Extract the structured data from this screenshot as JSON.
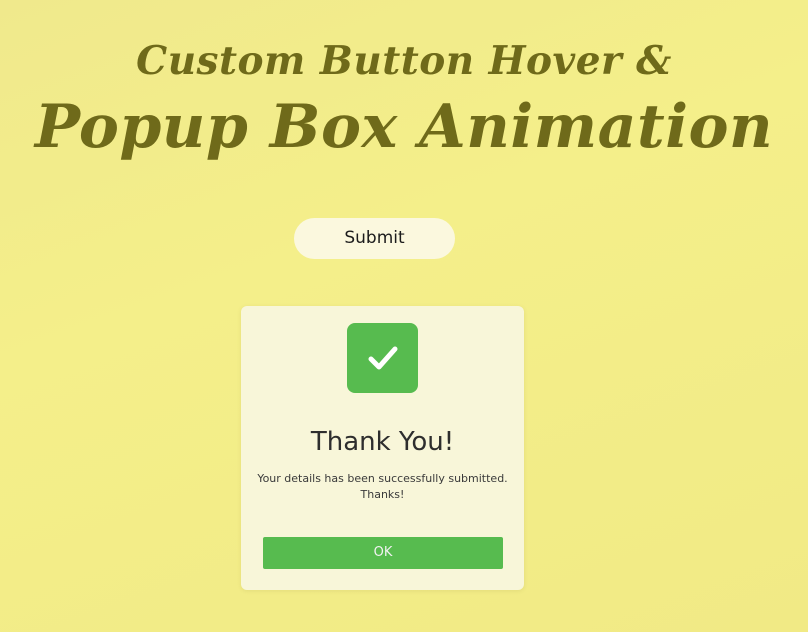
{
  "header": {
    "line1": "Custom Button Hover &",
    "line2": "Popup Box Animation"
  },
  "submit_button": {
    "label": "Submit"
  },
  "popup": {
    "icon": "checkmark-icon",
    "title": "Thank You!",
    "message": "Your details has been successfully submitted. Thanks!",
    "ok_label": "OK"
  },
  "colors": {
    "background": "#f2ec88",
    "title": "#6f6a1a",
    "accent_green": "#57bb4f",
    "popup_bg": "#f8f6d9",
    "button_bg": "#fbf8de"
  }
}
